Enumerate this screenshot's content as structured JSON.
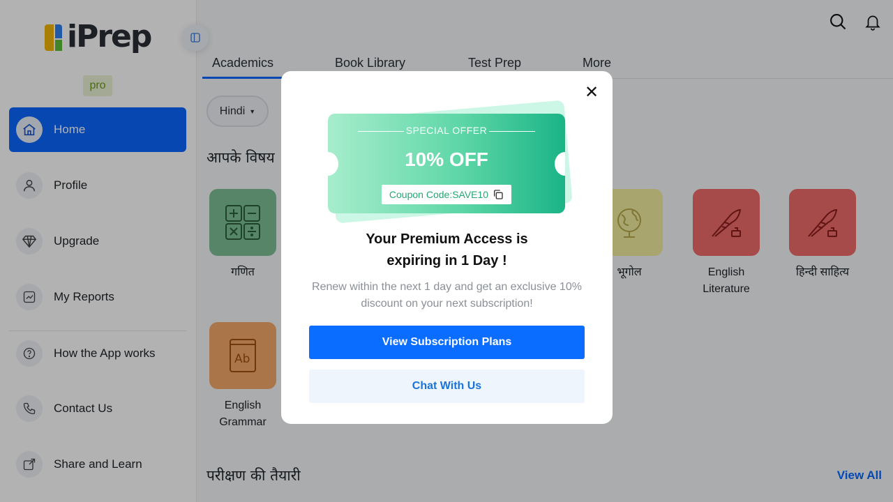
{
  "app": {
    "brand": "iPrep",
    "plan_badge": "pro"
  },
  "sidebar": {
    "items": [
      {
        "label": "Home",
        "icon": "home-icon"
      },
      {
        "label": "Profile",
        "icon": "user-icon"
      },
      {
        "label": "Upgrade",
        "icon": "diamond-icon"
      },
      {
        "label": "My Reports",
        "icon": "chart-icon"
      },
      {
        "label": "How the App works",
        "icon": "help-icon"
      },
      {
        "label": "Contact Us",
        "icon": "phone-icon"
      },
      {
        "label": "Share and Learn",
        "icon": "share-icon"
      }
    ],
    "active_index": 0
  },
  "tabs": [
    {
      "label": "Academics"
    },
    {
      "label": "Book Library"
    },
    {
      "label": "Test Prep"
    },
    {
      "label": "More"
    }
  ],
  "language_selector": {
    "value": "Hindi"
  },
  "sections": {
    "subjects_title": "आपके विषय",
    "test_prep_title": "परीक्षण की तैयारी",
    "view_all": "View All"
  },
  "subjects": [
    {
      "name": "गणित",
      "icon": "math-icon",
      "color": "#7dbf94"
    },
    {
      "name": "भूगोल",
      "icon": "globe-icon",
      "color": "#f2eca0"
    },
    {
      "name": "English Literature",
      "icon": "quill-icon",
      "color": "#f06a6a"
    },
    {
      "name": "हिन्दी साहित्य",
      "icon": "quill-icon",
      "color": "#f06a6a"
    },
    {
      "name": "English Grammar",
      "icon": "book-ab-icon",
      "color": "#f5a86a"
    }
  ],
  "modal": {
    "offer_label": "SPECIAL OFFER",
    "offer_value": "10% OFF",
    "coupon_text": "Coupon Code:SAVE10",
    "title_line1": "Your Premium Access is",
    "title_line2": "expiring in 1 Day !",
    "subtitle": "Renew within the next 1 day and get an exclusive 10% discount on your next subscription!",
    "primary_button": "View Subscription Plans",
    "secondary_button": "Chat With Us"
  },
  "colors": {
    "primary": "#0a66ff",
    "offer_gradient_start": "#a7edcc",
    "offer_gradient_end": "#1ab487"
  }
}
